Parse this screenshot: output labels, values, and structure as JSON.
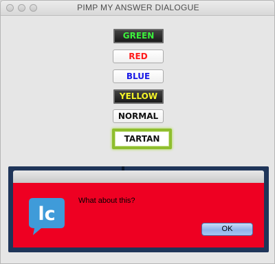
{
  "window": {
    "title": "PIMP MY ANSWER DIALOGUE"
  },
  "buttons": {
    "green": "GREEN",
    "red": "RED",
    "blue": "BLUE",
    "yellow": "YELLOW",
    "normal": "NORMAL",
    "tartan": "TARTAN"
  },
  "dialog": {
    "message": "What about this?",
    "ok_label": "OK",
    "icon": "livecode-logo-icon",
    "logo_text": "lc"
  },
  "colors": {
    "dialog_background": "#ee0022",
    "green_text": "#3cf03c",
    "red_text": "#ff1a1a",
    "blue_text": "#1a1ae6",
    "yellow_text": "#f4f428",
    "tartan_border": "#8fbe2e",
    "logo_blue": "#3f9bd9"
  }
}
